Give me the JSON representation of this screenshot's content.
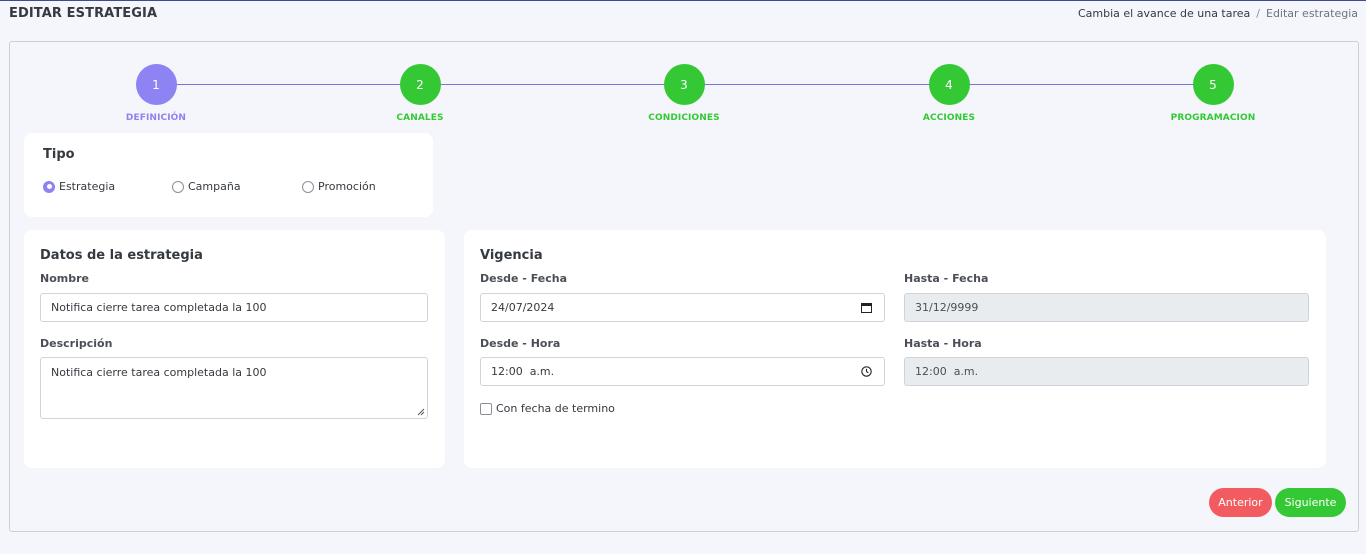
{
  "header": {
    "title": "EDITAR ESTRATEGIA",
    "breadcrumb": [
      "Cambia el avance de una tarea",
      "Editar estrategia"
    ],
    "breadcrumb_sep": "/"
  },
  "stepper": {
    "steps": [
      {
        "number": "1",
        "label": "DEFINICIÓN",
        "state": "active"
      },
      {
        "number": "2",
        "label": "CANALES",
        "state": "done"
      },
      {
        "number": "3",
        "label": "CONDICIONES",
        "state": "done"
      },
      {
        "number": "4",
        "label": "ACCIONES",
        "state": "done"
      },
      {
        "number": "5",
        "label": "PROGRAMACION",
        "state": "done"
      }
    ]
  },
  "tipo": {
    "title": "Tipo",
    "options": [
      {
        "label": "Estrategia",
        "checked": true
      },
      {
        "label": "Campaña",
        "checked": false
      },
      {
        "label": "Promoción",
        "checked": false
      }
    ]
  },
  "datos": {
    "title": "Datos de la estrategia",
    "nombre_label": "Nombre",
    "nombre_value": "Notifica cierre tarea completada la 100",
    "descripcion_label": "Descripción",
    "descripcion_value": "Notifica cierre tarea completada la 100"
  },
  "vigencia": {
    "title": "Vigencia",
    "desde_fecha_label": "Desde - Fecha",
    "desde_fecha_value": "24/07/2024",
    "hasta_fecha_label": "Hasta - Fecha",
    "hasta_fecha_value": "31/12/9999",
    "desde_hora_label": "Desde - Hora",
    "desde_hora_value": "12:00  a.m.",
    "hasta_hora_label": "Hasta - Hora",
    "hasta_hora_value": "12:00  a.m.",
    "con_fecha_termino_label": "Con fecha de termino",
    "con_fecha_termino_checked": false
  },
  "actions": {
    "prev_label": "Anterior",
    "next_label": "Siguiente"
  },
  "colors": {
    "active": "#8d83f2",
    "done": "#34c934",
    "danger": "#f25c61"
  }
}
